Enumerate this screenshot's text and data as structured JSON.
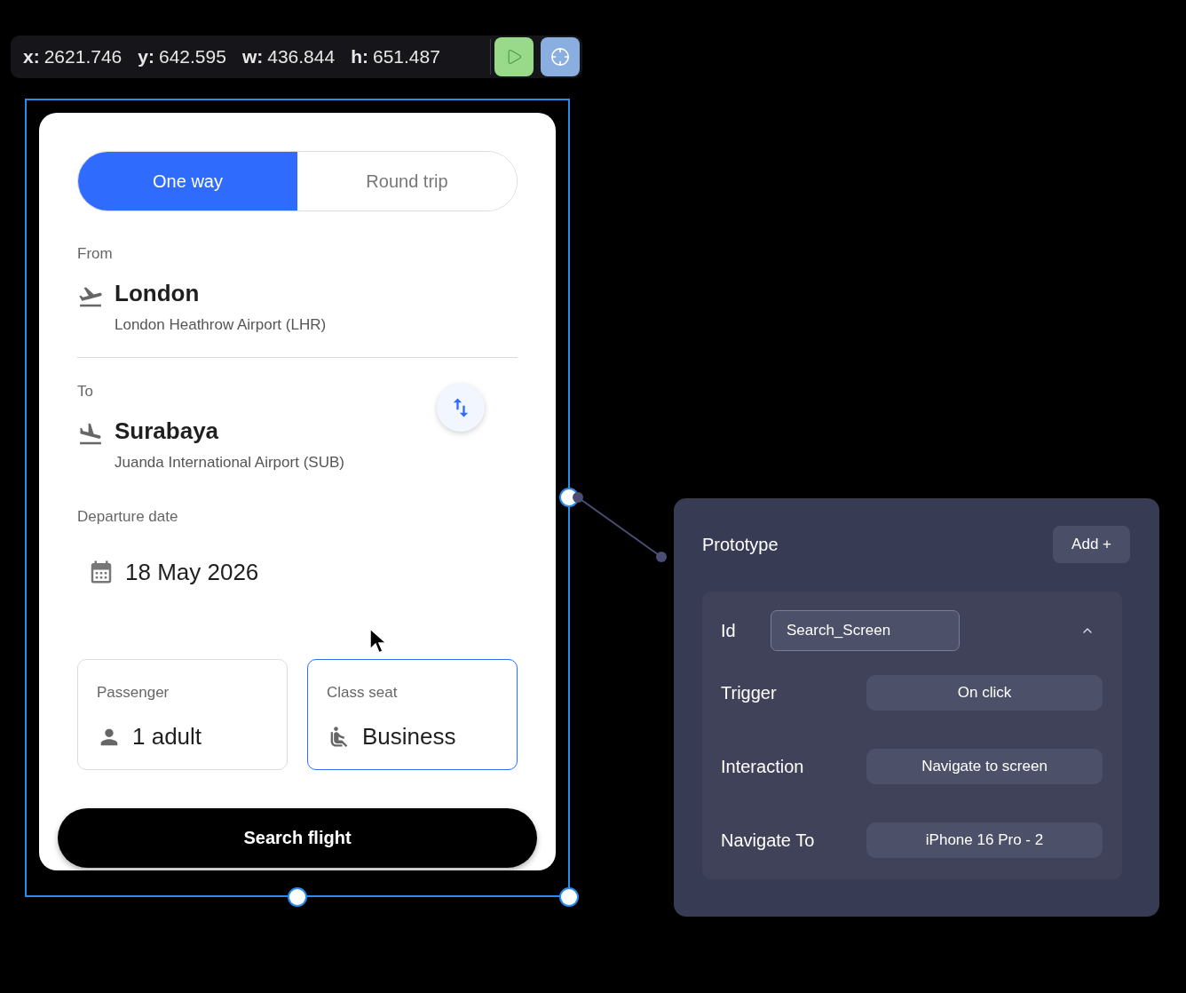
{
  "toolbar": {
    "fields": [
      {
        "label": "x:",
        "value": "2621.746"
      },
      {
        "label": "y:",
        "value": "642.595"
      },
      {
        "label": "w:",
        "value": "436.844"
      },
      {
        "label": "h:",
        "value": "651.487"
      }
    ]
  },
  "card": {
    "trip_tabs": [
      {
        "label": "One way",
        "selected": true
      },
      {
        "label": "Round trip",
        "selected": false
      }
    ],
    "from": {
      "label": "From",
      "city": "London",
      "airport": "London Heathrow Airport (LHR)"
    },
    "to": {
      "label": "To",
      "city": "Surabaya",
      "airport": "Juanda International Airport (SUB)"
    },
    "departure": {
      "label": "Departure date",
      "date": "18 May 2026"
    },
    "options": [
      {
        "kind": "passenger",
        "label": "Passenger",
        "value": "1 adult",
        "selected": false
      },
      {
        "kind": "seat",
        "label": "Class seat",
        "value": "Business",
        "selected": true
      }
    ],
    "search_button": "Search flight"
  },
  "prototype": {
    "title": "Prototype",
    "add_button": "Add +",
    "id_label": "Id",
    "id_value": "Search_Screen",
    "expanded": true,
    "rows": [
      {
        "label": "Trigger",
        "value": "On click"
      },
      {
        "label": "Interaction",
        "value": "Navigate to screen"
      },
      {
        "label": "Navigate To",
        "value": "iPhone 16 Pro - 2"
      }
    ]
  }
}
